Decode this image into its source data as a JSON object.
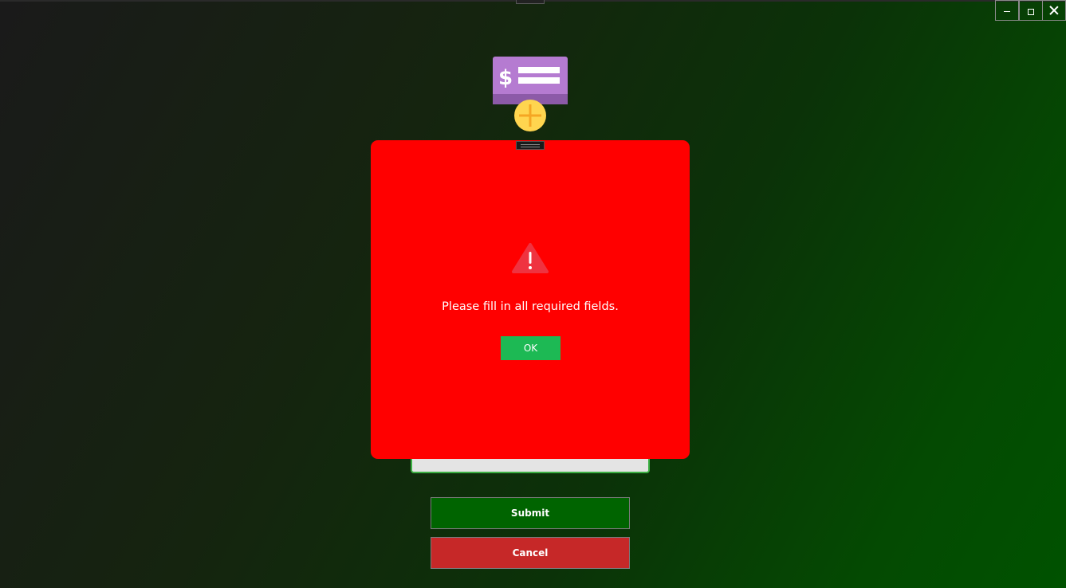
{
  "window": {
    "controls": {
      "minimize_icon": "minimize-icon",
      "maximize_icon": "maximize-icon",
      "close_icon": "close-icon"
    }
  },
  "app": {
    "logo_icon": "add-payment-icon",
    "colors": {
      "logo_card": "#b57bd1",
      "logo_plus": "#ffd54f"
    }
  },
  "form": {
    "submit_label": "Submit",
    "cancel_label": "Cancel",
    "colors": {
      "submit": "#006400",
      "cancel": "#c62828"
    }
  },
  "dialog": {
    "icon": "warning-icon",
    "message": "Please fill in all required fields.",
    "ok_label": "OK",
    "colors": {
      "background": "#ff0000",
      "ok_button": "#1db954",
      "warning": "#ef3340"
    }
  }
}
